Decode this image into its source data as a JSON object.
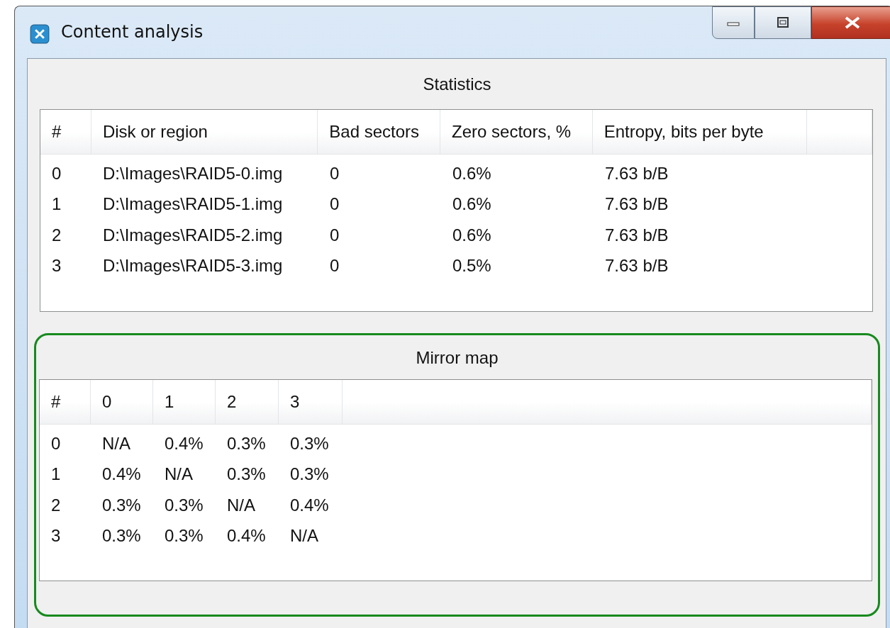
{
  "window": {
    "title": "Content analysis"
  },
  "statistics": {
    "title": "Statistics",
    "columns": [
      "#",
      "Disk or region",
      "Bad sectors",
      "Zero sectors, %",
      "Entropy, bits per byte"
    ],
    "rows": [
      [
        "0",
        "D:\\Images\\RAID5-0.img",
        "0",
        "0.6%",
        "7.63 b/B"
      ],
      [
        "1",
        "D:\\Images\\RAID5-1.img",
        "0",
        "0.6%",
        "7.63 b/B"
      ],
      [
        "2",
        "D:\\Images\\RAID5-2.img",
        "0",
        "0.6%",
        "7.63 b/B"
      ],
      [
        "3",
        "D:\\Images\\RAID5-3.img",
        "0",
        "0.5%",
        "7.63 b/B"
      ]
    ]
  },
  "mirror_map": {
    "title": "Mirror map",
    "highlighted": true,
    "columns": [
      "#",
      "0",
      "1",
      "2",
      "3"
    ],
    "rows": [
      [
        "0",
        "N/A",
        "0.4%",
        "0.3%",
        "0.3%"
      ],
      [
        "1",
        "0.4%",
        "N/A",
        "0.3%",
        "0.3%"
      ],
      [
        "2",
        "0.3%",
        "0.3%",
        "N/A",
        "0.4%"
      ],
      [
        "3",
        "0.3%",
        "0.3%",
        "0.4%",
        "N/A"
      ]
    ]
  }
}
